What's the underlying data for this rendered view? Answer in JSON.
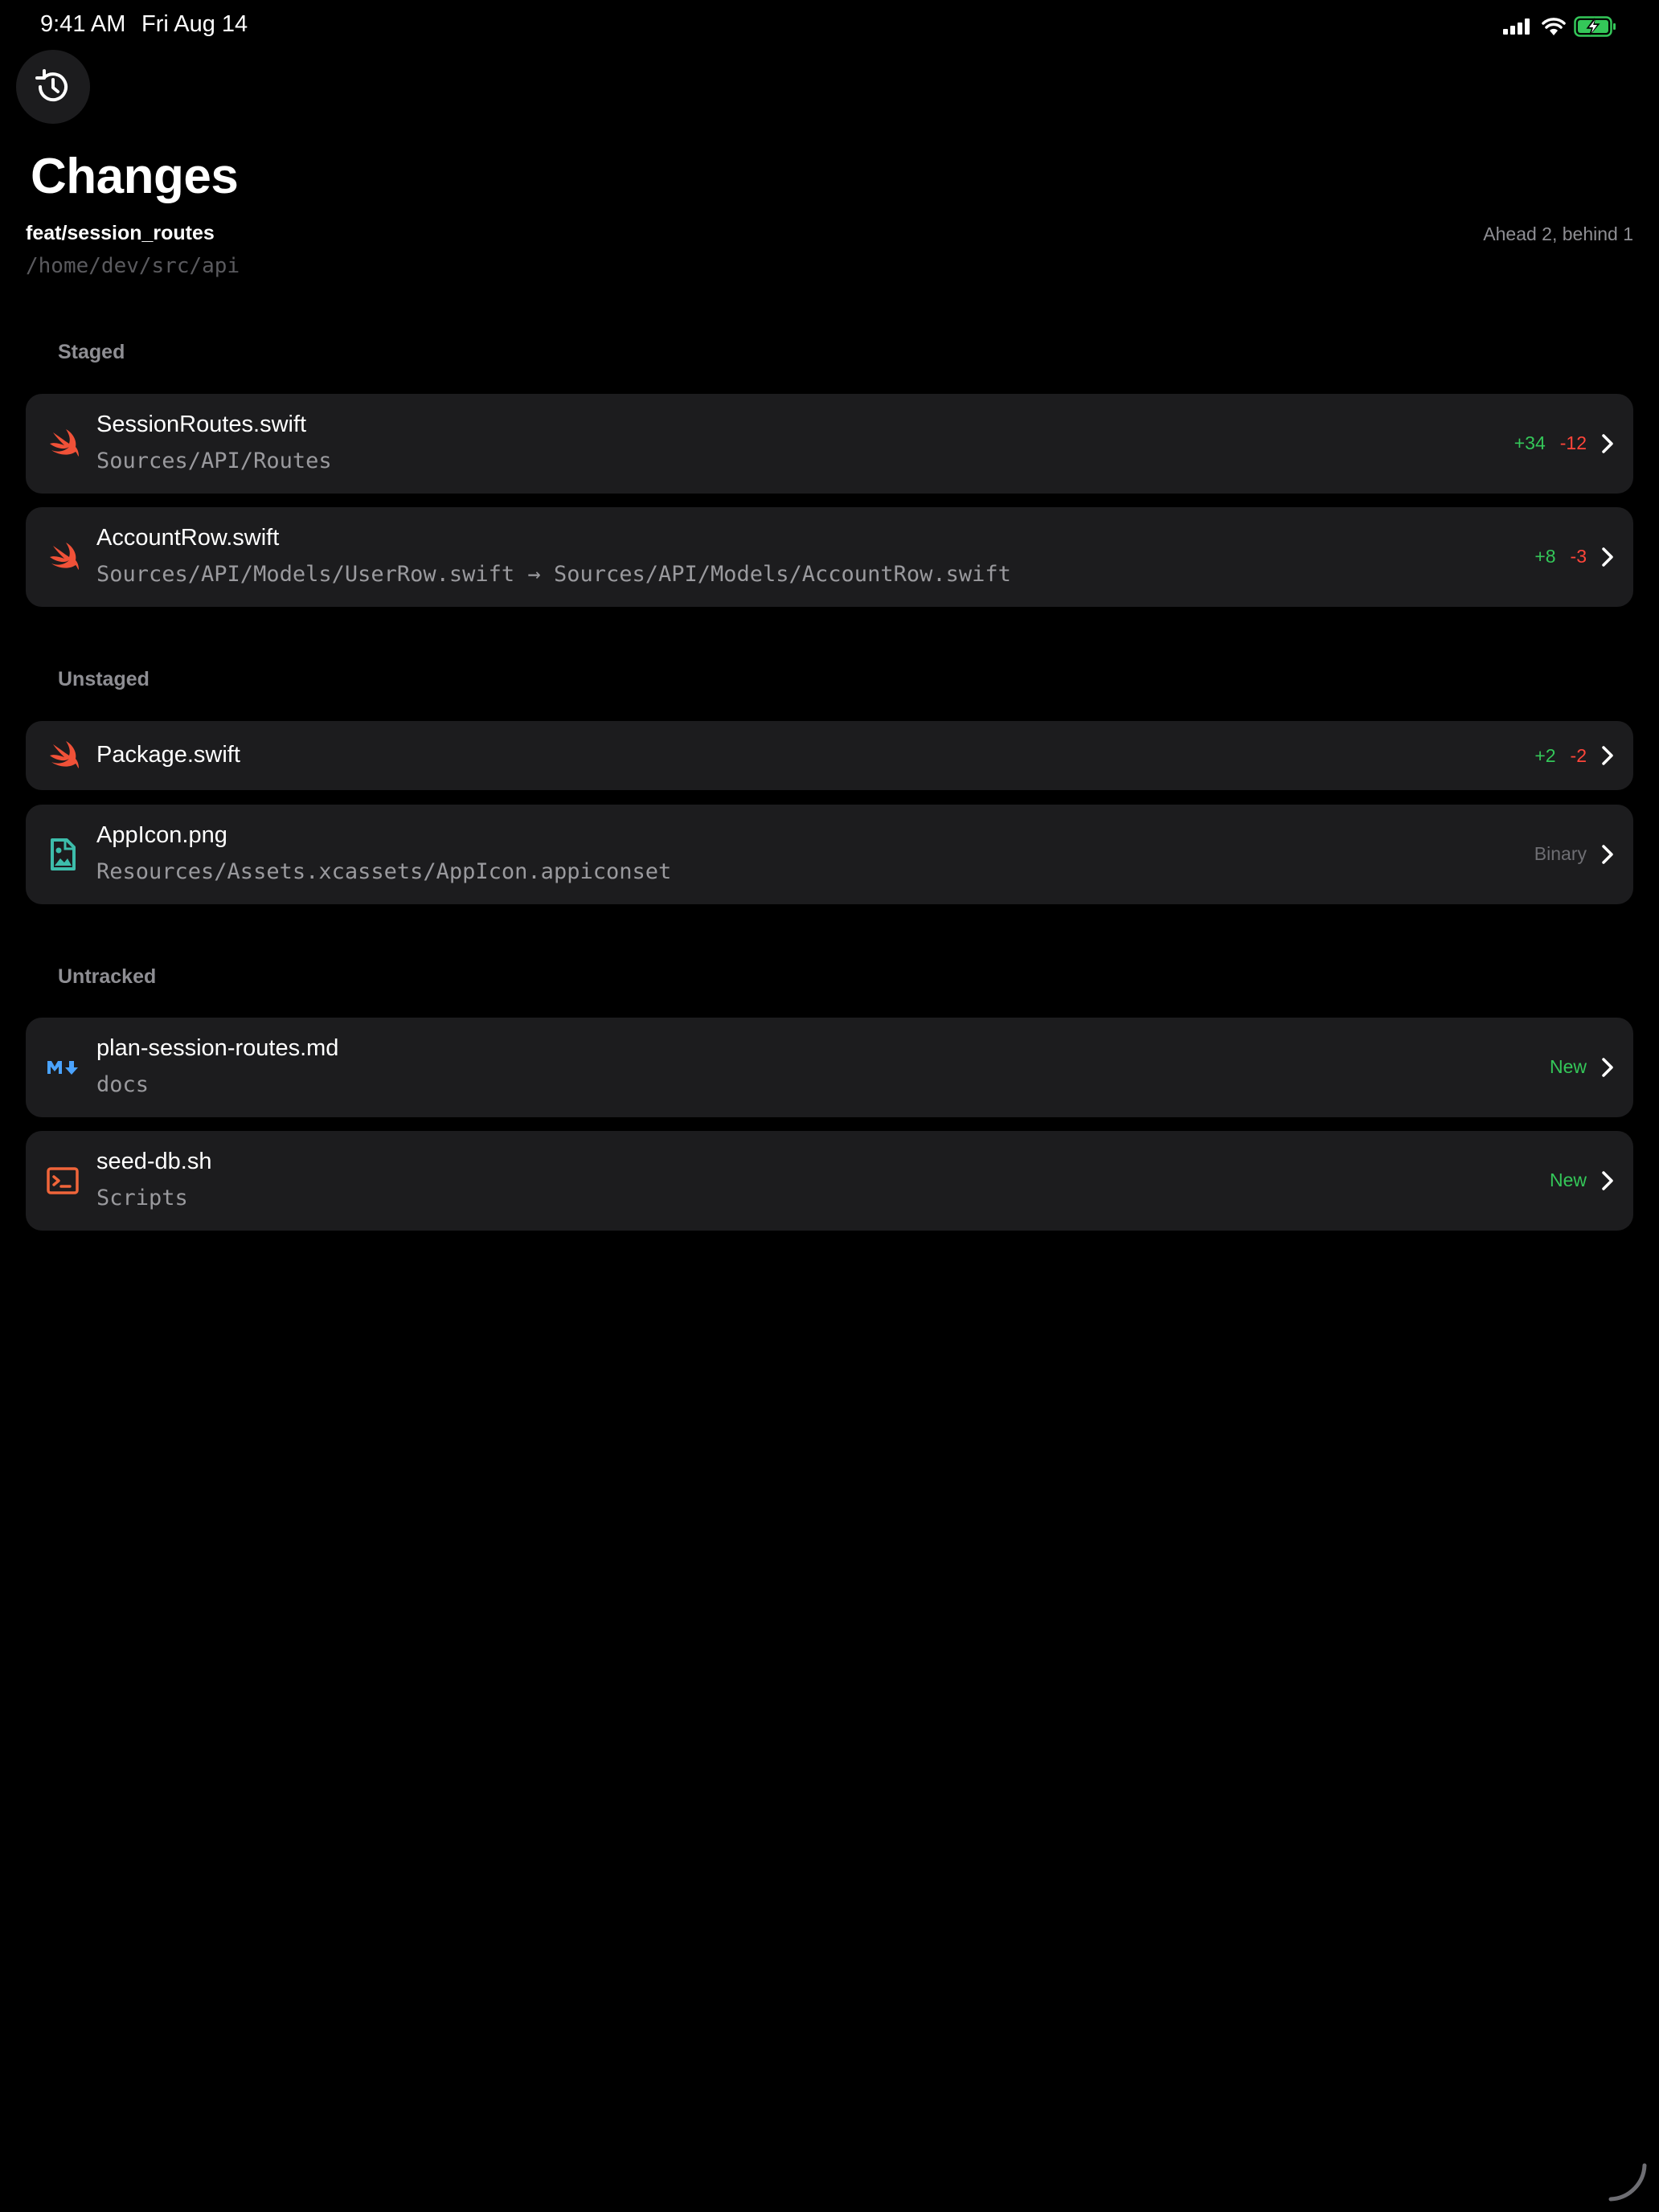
{
  "status_bar": {
    "time": "9:41 AM",
    "date": "Fri Aug 14",
    "icons": [
      "signal-icon",
      "wifi-icon",
      "battery-charging-icon"
    ]
  },
  "header": {
    "history_icon": "history-icon",
    "title": "Changes",
    "branch": "feat/session_routes",
    "path": "/home/dev/src/api",
    "sync": "Ahead 2, behind 1"
  },
  "colors": {
    "background": "#000000",
    "row_background": "#1c1c1e",
    "additions": "#34c759",
    "deletions": "#ff453a",
    "swift": "#f05138",
    "image": "#3dbdab",
    "markdown": "#4aa3ff",
    "shell": "#f0653a"
  },
  "sections": {
    "staged": {
      "label": "Staged",
      "items": [
        {
          "name": "SessionRoutes.swift",
          "dir": "Sources/API/Routes",
          "icon": "swift-icon",
          "additions": "+34",
          "deletions": "-12"
        },
        {
          "name": "AccountRow.swift",
          "dir": "Sources/API/Models/UserRow.swift → Sources/API/Models/AccountRow.swift",
          "icon": "swift-icon",
          "additions": "+8",
          "deletions": "-3"
        }
      ]
    },
    "unstaged": {
      "label": "Unstaged",
      "items": [
        {
          "name": "Package.swift",
          "icon": "swift-icon",
          "additions": "+2",
          "deletions": "-2"
        },
        {
          "name": "AppIcon.png",
          "dir": "Resources/Assets.xcassets/AppIcon.appiconset",
          "icon": "image-file-icon",
          "status": "Binary"
        }
      ]
    },
    "untracked": {
      "label": "Untracked",
      "items": [
        {
          "name": "plan-session-routes.md",
          "dir": "docs",
          "icon": "markdown-icon",
          "status": "New"
        },
        {
          "name": "seed-db.sh",
          "dir": "Scripts",
          "icon": "terminal-icon",
          "status": "New"
        }
      ]
    }
  }
}
